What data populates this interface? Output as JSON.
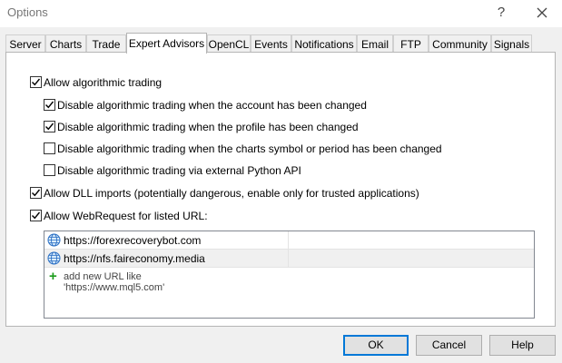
{
  "window": {
    "title": "Options",
    "help_glyph": "?"
  },
  "tabs": [
    {
      "label": "Server",
      "active": false
    },
    {
      "label": "Charts",
      "active": false
    },
    {
      "label": "Trade",
      "active": false
    },
    {
      "label": "Expert Advisors",
      "active": true
    },
    {
      "label": "OpenCL",
      "active": false
    },
    {
      "label": "Events",
      "active": false
    },
    {
      "label": "Notifications",
      "active": false
    },
    {
      "label": "Email",
      "active": false
    },
    {
      "label": "FTP",
      "active": false
    },
    {
      "label": "Community",
      "active": false
    },
    {
      "label": "Signals",
      "active": false
    }
  ],
  "options": {
    "allow_algo": {
      "label": "Allow algorithmic trading",
      "checked": true
    },
    "disable_account": {
      "label": "Disable algorithmic trading when the account has been changed",
      "checked": true
    },
    "disable_profile": {
      "label": "Disable algorithmic trading when the profile has been changed",
      "checked": true
    },
    "disable_symbol": {
      "label": "Disable algorithmic trading when the charts symbol or period has been changed",
      "checked": false
    },
    "disable_python": {
      "label": "Disable algorithmic trading via external Python API",
      "checked": false
    },
    "allow_dll": {
      "label": "Allow DLL imports (potentially dangerous, enable only for trusted applications)",
      "checked": true
    },
    "allow_webrequest": {
      "label": "Allow WebRequest for listed URL:",
      "checked": true
    }
  },
  "urls": {
    "items": [
      {
        "url": "https://forexrecoverybot.com",
        "selected": false
      },
      {
        "url": "https://nfs.faireconomy.media",
        "selected": true
      }
    ],
    "add_label": "add new URL like 'https://www.mql5.com'",
    "icon": "globe-icon"
  },
  "buttons": {
    "ok": "OK",
    "cancel": "Cancel",
    "help": "Help"
  },
  "colors": {
    "accent": "#0078d7",
    "check": "#000000",
    "plus": "#1b9b1b"
  }
}
